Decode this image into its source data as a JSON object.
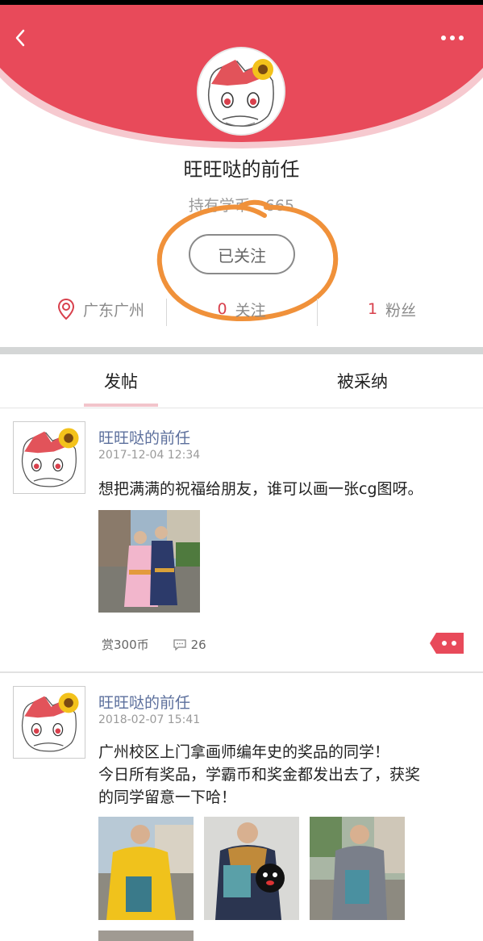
{
  "colors": {
    "brand_red": "#e84a5a",
    "link_blue": "#5c6f9c",
    "annotation_orange": "#f0913a"
  },
  "header": {
    "back_icon": "chevron-left-icon",
    "more_icon": "more-dots-icon"
  },
  "profile": {
    "name": "旺旺哒的前任",
    "coins_text": "持有学币：665",
    "follow_label": "已关注",
    "location": "广东广州",
    "following_count": "0",
    "following_label": "关注",
    "followers_count": "1",
    "followers_label": "粉丝"
  },
  "tabs": [
    {
      "label": "发帖",
      "active": true
    },
    {
      "label": "被采纳",
      "active": false
    }
  ],
  "posts": [
    {
      "author": "旺旺哒的前任",
      "date": "2017-12-04 12:34",
      "text": "想把满满的祝福给朋友，谁可以画一张cg图呀。",
      "reward": "赏300币",
      "comments": "26"
    },
    {
      "author": "旺旺哒的前任",
      "date": "2018-02-07 15:41",
      "text_lines": [
        "广州校区上门拿画师编年史的奖品的同学！",
        "今日所有奖品，学霸币和奖金都发出去了，获奖",
        "的同学留意一下哈！"
      ]
    }
  ]
}
